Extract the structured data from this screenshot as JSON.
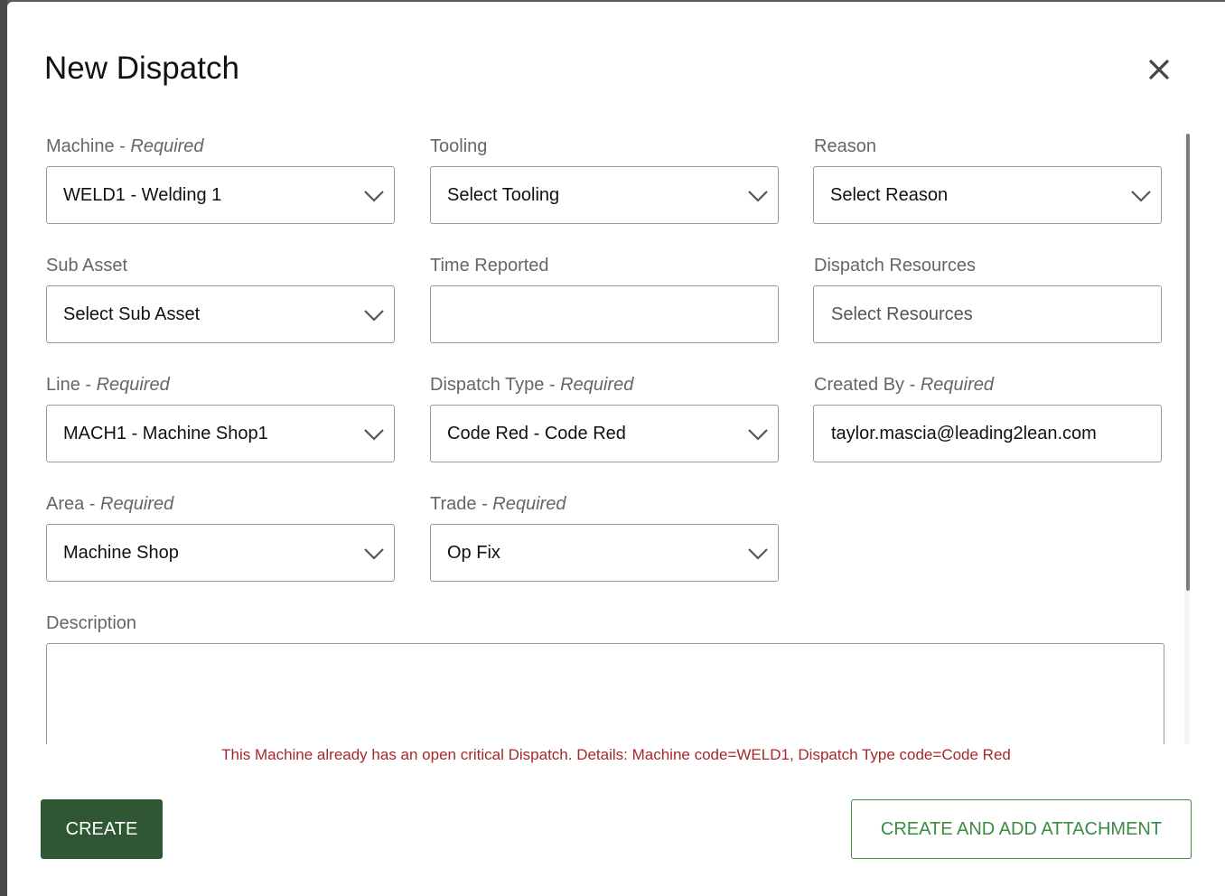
{
  "modal": {
    "title": "New Dispatch"
  },
  "required_suffix": "Required",
  "separator": " - ",
  "fields": {
    "machine": {
      "label": "Machine",
      "value": "WELD1 - Welding 1"
    },
    "tooling": {
      "label": "Tooling",
      "value": "Select Tooling"
    },
    "reason": {
      "label": "Reason",
      "value": "Select Reason"
    },
    "sub_asset": {
      "label": "Sub Asset",
      "value": "Select Sub Asset"
    },
    "time_reported": {
      "label": "Time Reported",
      "value": ""
    },
    "dispatch_resources": {
      "label": "Dispatch Resources",
      "placeholder": "Select Resources"
    },
    "line": {
      "label": "Line",
      "value": "MACH1 - Machine Shop1"
    },
    "dispatch_type": {
      "label": "Dispatch Type",
      "value": "Code Red - Code Red"
    },
    "created_by": {
      "label": "Created By",
      "value": "taylor.mascia@leading2lean.com"
    },
    "area": {
      "label": "Area",
      "value": "Machine Shop"
    },
    "trade": {
      "label": "Trade",
      "value": "Op Fix"
    },
    "description": {
      "label": "Description",
      "value": ""
    }
  },
  "error_message": "This Machine already has an open critical Dispatch. Details: Machine code=WELD1, Dispatch Type code=Code Red",
  "buttons": {
    "create": "CREATE",
    "create_attach": "CREATE AND ADD ATTACHMENT"
  },
  "colors": {
    "primary": "#2f5733",
    "outline_green": "#3d8a45",
    "error": "#a5282a"
  }
}
